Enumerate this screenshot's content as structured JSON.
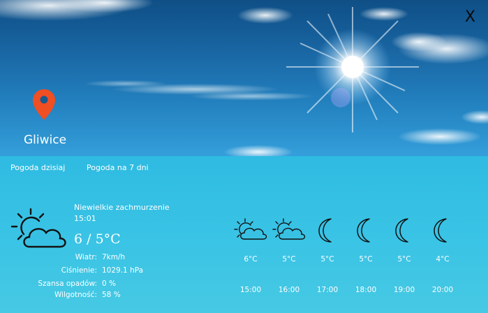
{
  "header": {
    "close_label": "X",
    "city": "Gliwice"
  },
  "tabs": [
    {
      "label": "Pogoda dzisiaj"
    },
    {
      "label": "Pogoda na 7 dni"
    }
  ],
  "current": {
    "description": "Niewielkie zachmurzenie",
    "time": "15:01",
    "temperature": "6 / 5°C",
    "icon": "partly-cloudy-day-icon",
    "details": [
      {
        "label": "Wiatr:",
        "value": "7km/h"
      },
      {
        "label": "Ciśnienie:",
        "value": "1029.1 hPa"
      },
      {
        "label": "Szansa opadów:",
        "value": "0 %"
      },
      {
        "label": "Wilgotność:",
        "value": "58 %"
      }
    ]
  },
  "hourly": [
    {
      "time": "15:00",
      "temp": "6°C",
      "icon": "partly-cloudy-day-icon"
    },
    {
      "time": "16:00",
      "temp": "5°C",
      "icon": "partly-cloudy-day-icon"
    },
    {
      "time": "17:00",
      "temp": "5°C",
      "icon": "moon-icon"
    },
    {
      "time": "18:00",
      "temp": "5°C",
      "icon": "moon-icon"
    },
    {
      "time": "19:00",
      "temp": "5°C",
      "icon": "moon-icon"
    },
    {
      "time": "20:00",
      "temp": "4°C",
      "icon": "moon-icon"
    }
  ],
  "colors": {
    "panel": "#37c0e3",
    "pin": "#f04e23",
    "text": "#ffffff",
    "icon_stroke": "#111111"
  }
}
